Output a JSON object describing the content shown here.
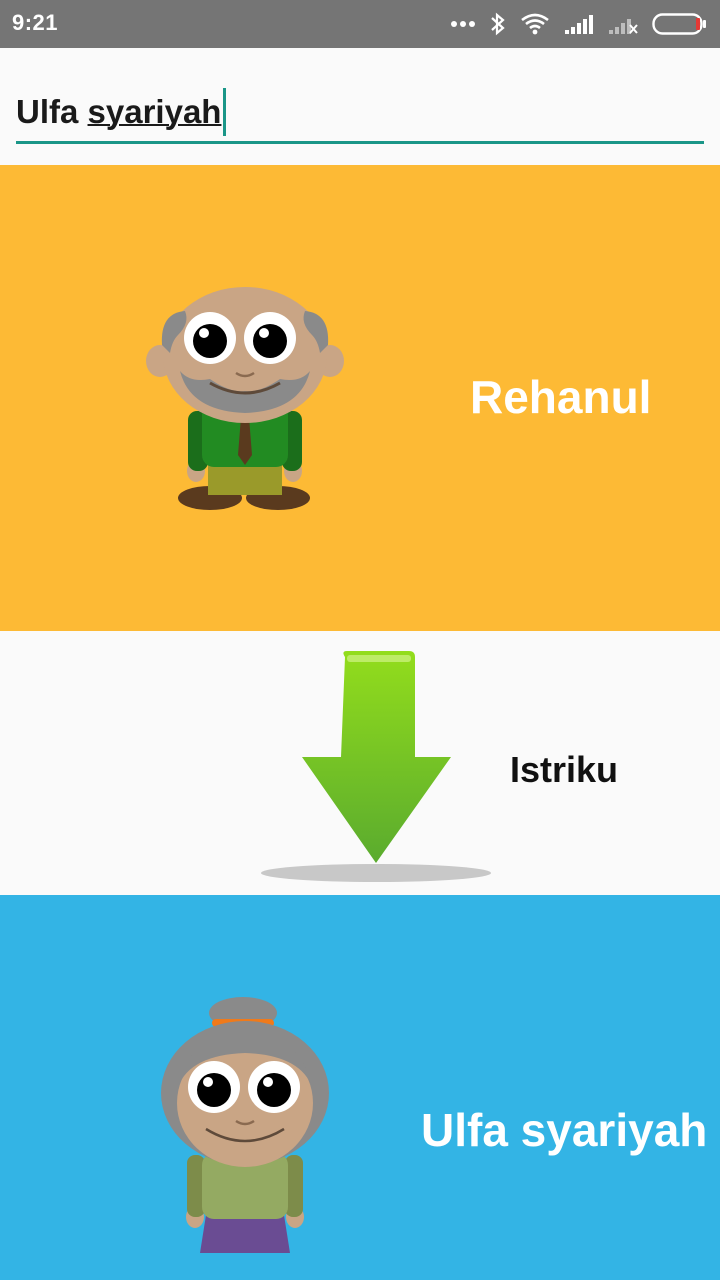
{
  "status_bar": {
    "time": "9:21",
    "icons": [
      "more-dots-icon",
      "bluetooth-icon",
      "wifi-icon",
      "signal-icon",
      "signal-no-sim-icon",
      "battery-icon"
    ]
  },
  "input": {
    "value_first": "Ulfa ",
    "value_second": "syariyah"
  },
  "husband": {
    "name": "Rehanul",
    "background": "#fdba35",
    "character_icon": "old-man-character-icon"
  },
  "relation": {
    "label": "Istriku",
    "arrow_icon": "green-down-arrow-icon"
  },
  "wife": {
    "name": "Ulfa syariyah",
    "background": "#33b4e5",
    "character_icon": "old-woman-character-icon"
  },
  "colors": {
    "status_bar": "#757575",
    "accent": "#1a9688",
    "arrow_green": "#7cc22a"
  }
}
